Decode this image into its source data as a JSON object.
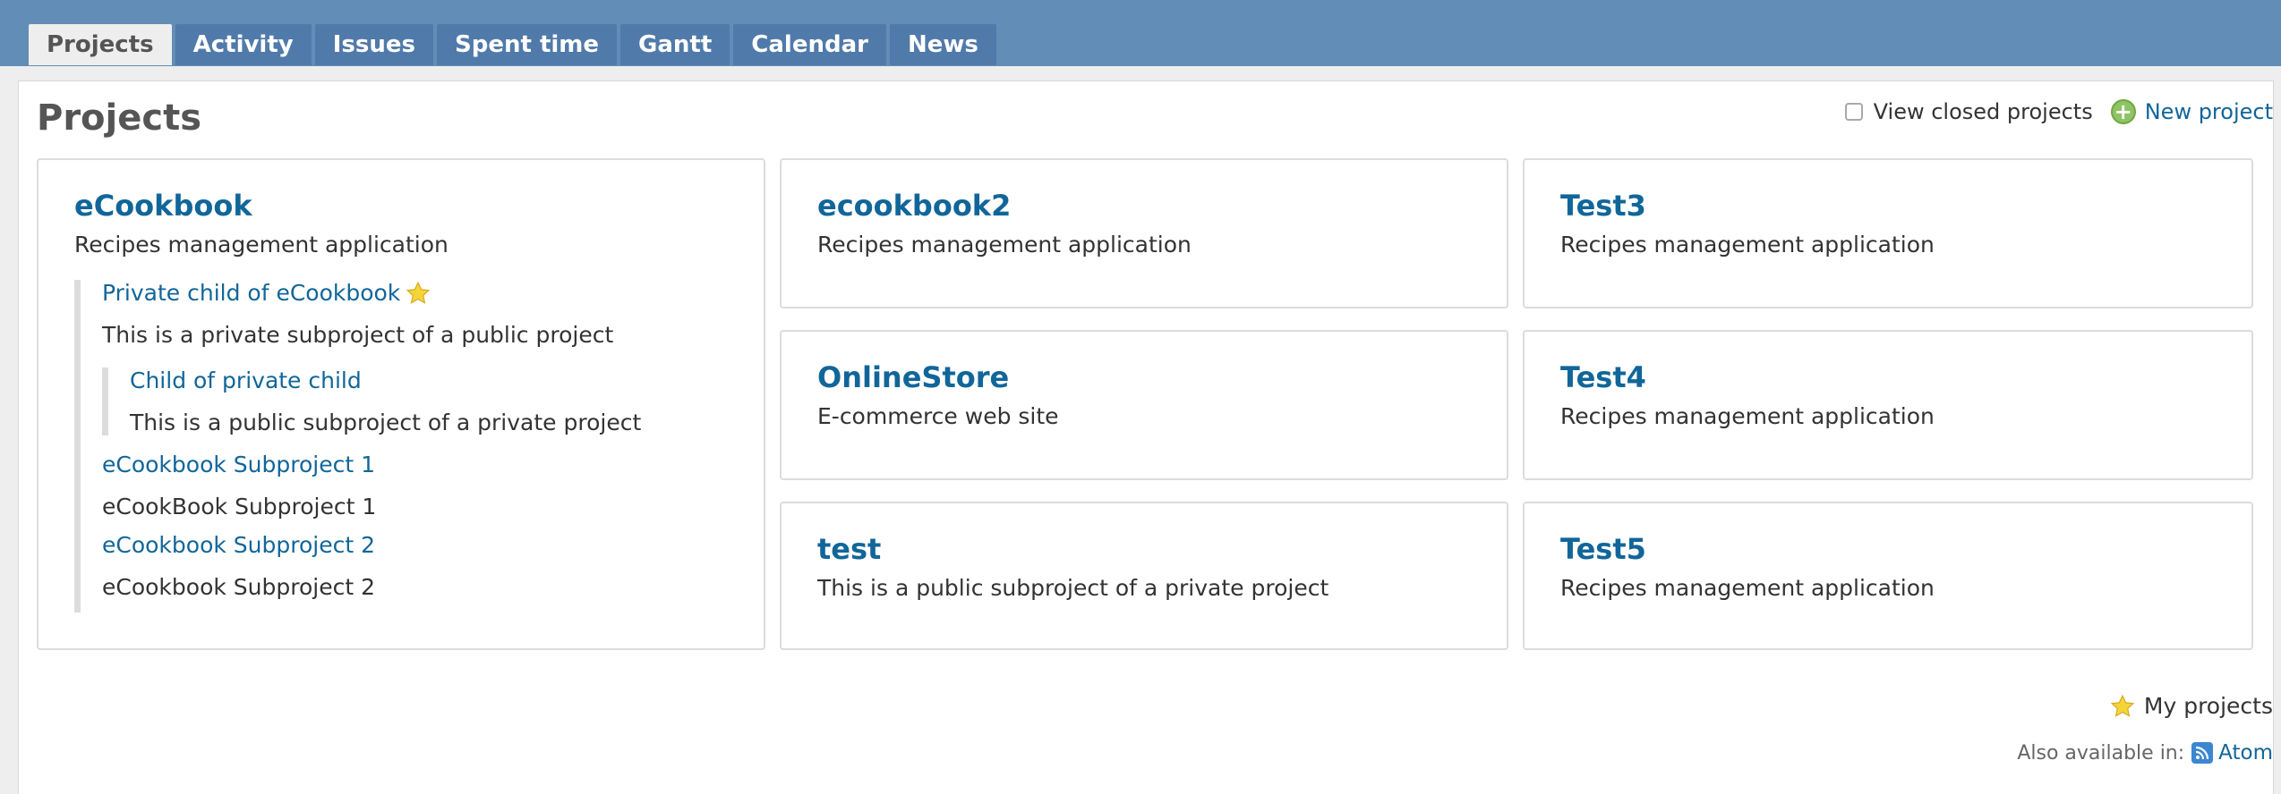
{
  "tabs": [
    "Projects",
    "Activity",
    "Issues",
    "Spent time",
    "Gantt",
    "Calendar",
    "News"
  ],
  "page_title": "Projects",
  "contextual": {
    "view_closed_label": "View closed projects",
    "new_project_label": "New project"
  },
  "projects": [
    {
      "name": "eCookbook",
      "description": "Recipes management application",
      "children": [
        {
          "name": "Private child of eCookbook",
          "description": "This is a private subproject of a public project",
          "starred": true,
          "children": [
            {
              "name": "Child of private child",
              "description": "This is a public subproject of a private project"
            }
          ]
        },
        {
          "name": "eCookbook Subproject 1",
          "description": "eCookBook Subproject 1"
        },
        {
          "name": "eCookbook Subproject 2",
          "description": "eCookbook Subproject 2"
        }
      ]
    },
    {
      "name": "ecookbook2",
      "description": "Recipes management application"
    },
    {
      "name": "OnlineStore",
      "description": "E-commerce web site"
    },
    {
      "name": "test",
      "description": "This is a public subproject of a private project"
    },
    {
      "name": "Test3",
      "description": "Recipes management application"
    },
    {
      "name": "Test4",
      "description": "Recipes management application"
    },
    {
      "name": "Test5",
      "description": "Recipes management application"
    }
  ],
  "legend": {
    "my_projects_label": "My projects"
  },
  "footer": {
    "also_available_label": "Also available in:",
    "atom_label": "Atom"
  },
  "colors": {
    "header": "#628db6",
    "tab": "#507aaa",
    "link": "#116699",
    "star": "#f5d43a"
  }
}
